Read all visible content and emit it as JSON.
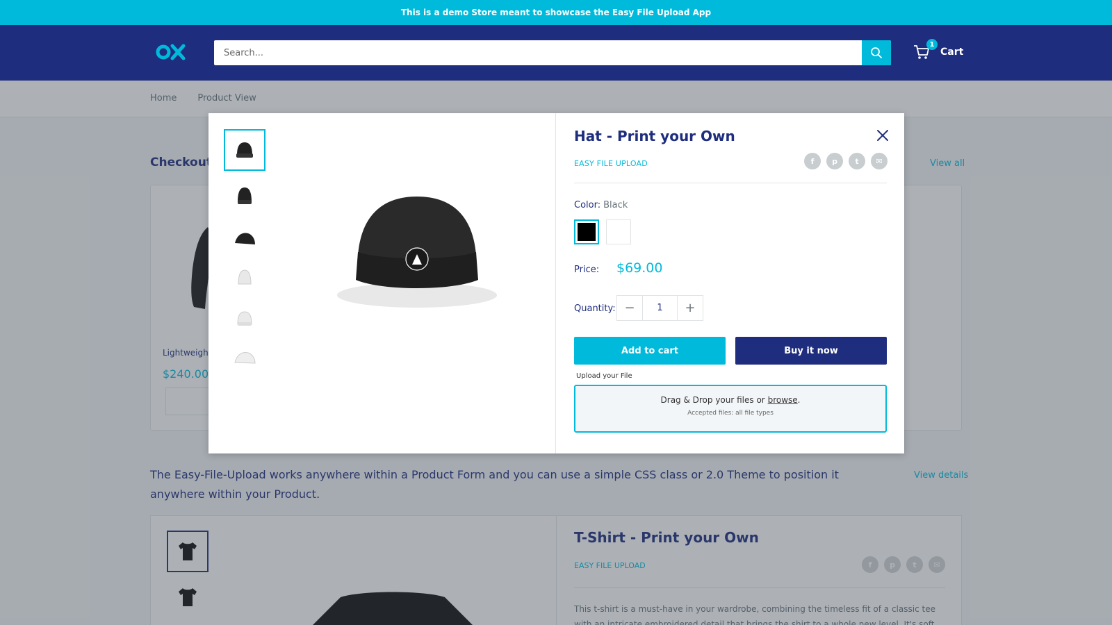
{
  "announcement": "This is a demo Store meant to showcase the Easy File Upload App",
  "header": {
    "search_placeholder": "Search...",
    "cart_label": "Cart",
    "cart_count": "1"
  },
  "breadcrumb": [
    "Home",
    "Product View"
  ],
  "background": {
    "section_title": "Checkout t",
    "view_all": "View all",
    "product_name": "Lightweight",
    "product_price": "$240.00",
    "promo_text": "The Easy-File-Upload works anywhere within a Product Form and you can use a simple CSS class or 2.0 Theme to position it anywhere within your Product.",
    "view_details": "View details",
    "tshirt_title": "T-Shirt - Print your Own",
    "tshirt_vendor": "EASY FILE UPLOAD",
    "tshirt_desc": "This t-shirt is a must-have in your wardrobe, combining the timeless fit of a classic tee with an intricate embroidered detail that brings the shirt to a whole new level. It's soft and"
  },
  "modal": {
    "title": "Hat - Print your Own",
    "vendor": "EASY FILE UPLOAD",
    "share_icons": [
      "facebook-icon",
      "pinterest-icon",
      "twitter-icon",
      "email-icon"
    ],
    "color_label": "Color:",
    "color_value": "Black",
    "swatches": [
      {
        "name": "Black",
        "color": "#000000"
      },
      {
        "name": "White",
        "color": "#ffffff"
      }
    ],
    "price_label": "Price:",
    "price": "$69.00",
    "quantity_label": "Quantity:",
    "quantity": "1",
    "add_to_cart": "Add to cart",
    "buy_now": "Buy it now",
    "upload_label": "Upload your File",
    "dropzone_text": "Drag & Drop your files or",
    "dropzone_browse": "browse",
    "dropzone_period": ".",
    "dropzone_sub": "Accepted files: all file types"
  },
  "colors": {
    "accent": "#00badb",
    "brand": "#1e2d7d"
  }
}
